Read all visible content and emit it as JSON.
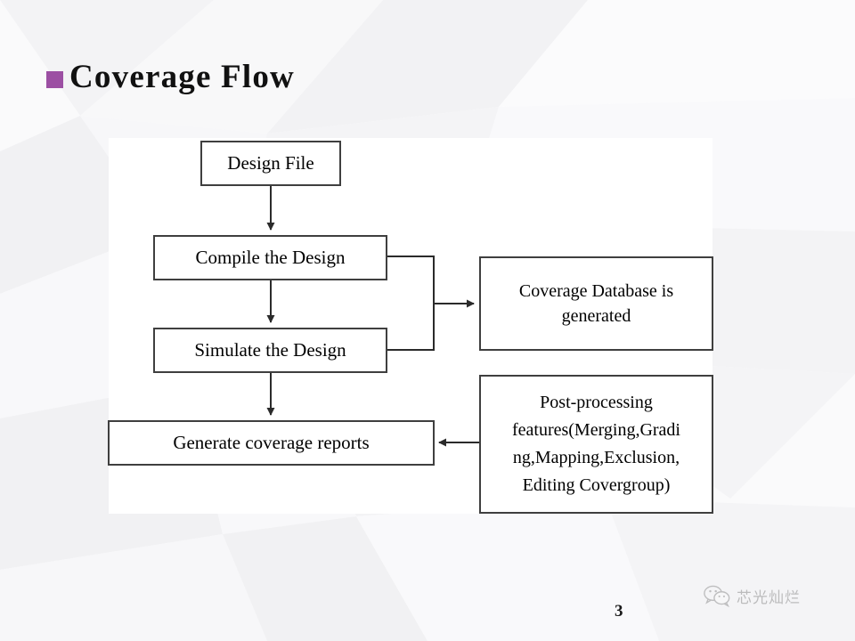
{
  "slide": {
    "title": "Coverage Flow",
    "bullet_color": "#9c4fa3",
    "page_number": "3",
    "background_color": "#fbfbfc",
    "panel_color": "#ffffff"
  },
  "flowchart": {
    "line_color": "#3f3f3f",
    "nodes": {
      "design_file": "Design File",
      "compile": "Compile the Design",
      "simulate": "Simulate the Design",
      "generate_reports": "Generate coverage reports",
      "coverage_db_line1": "Coverage Database is",
      "coverage_db_line2": "generated",
      "postproc_line1": "Post-processing",
      "postproc_line2": "features(Merging,Gradi",
      "postproc_line3": "ng,Mapping,Exclusion,",
      "postproc_line4": "Editing Covergroup)"
    }
  },
  "watermark": {
    "text": "芯光灿烂",
    "logo": "wechat-icon"
  }
}
